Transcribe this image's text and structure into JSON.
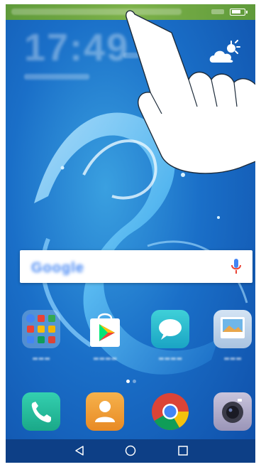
{
  "status_bar": {
    "background": "#6fa843",
    "battery_level": 0.6
  },
  "clock": {
    "time": "17:49"
  },
  "weather": {
    "icon": "partly-cloudy-icon"
  },
  "gesture": {
    "icon": "swipe-down-hand-icon"
  },
  "search": {
    "logo_text": "Google",
    "mic_icon": "mic-icon"
  },
  "apps": {
    "row1": [
      {
        "id": "google-folder",
        "icon": "folder-icon"
      },
      {
        "id": "play-store",
        "icon": "play-store-icon"
      },
      {
        "id": "messaging",
        "icon": "chat-bubble-icon"
      },
      {
        "id": "gallery",
        "icon": "gallery-icon"
      }
    ],
    "dock": [
      {
        "id": "phone",
        "icon": "phone-icon"
      },
      {
        "id": "contacts",
        "icon": "contacts-icon"
      },
      {
        "id": "chrome",
        "icon": "chrome-icon"
      },
      {
        "id": "camera",
        "icon": "camera-icon"
      }
    ]
  },
  "page_indicator": {
    "pages": 2,
    "current": 1
  },
  "nav_bar": {
    "buttons": [
      "back-icon",
      "home-icon",
      "recents-icon"
    ]
  },
  "colors": {
    "accent": "#2b7de0",
    "dock_bg": "#0d3f86"
  }
}
